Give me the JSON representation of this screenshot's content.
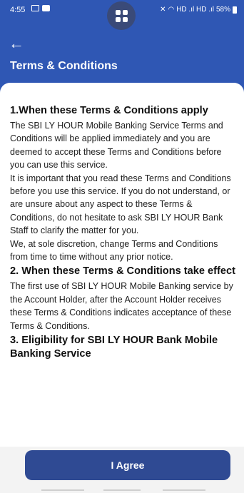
{
  "status_bar": {
    "time": "4:55",
    "signal_text": "HD .ıl HD .ıl",
    "battery": "58%"
  },
  "header": {
    "title": "Terms & Conditions"
  },
  "terms": {
    "sections": [
      {
        "heading": "1.When these Terms & Conditions apply",
        "paragraphs": [
          "The SBI LY HOUR Mobile Banking Service Terms and Conditions will be applied immediately and you are deemed to accept these Terms and Conditions before you can use this service.",
          "It is important that you read these Terms and Conditions before you use this service. If you do not understand, or are unsure about any aspect to these Terms & Conditions, do not hesitate to ask SBI LY HOUR Bank Staff to clarify the matter for you.",
          "We, at sole discretion, change Terms and Conditions from time to time without any prior notice."
        ]
      },
      {
        "heading": "2. When these Terms & Conditions take effect",
        "paragraphs": [
          "The first use of SBI LY HOUR Mobile Banking service by the Account Holder, after the Account Holder receives these Terms & Conditions indicates acceptance of these Terms & Conditions."
        ]
      },
      {
        "heading": "3. Eligibility for SBI LY HOUR Bank Mobile Banking Service",
        "paragraphs": []
      }
    ]
  },
  "footer": {
    "agree_label": "I Agree"
  },
  "colors": {
    "header_bg": "#2f57b4",
    "button_bg": "#2f4a93"
  }
}
